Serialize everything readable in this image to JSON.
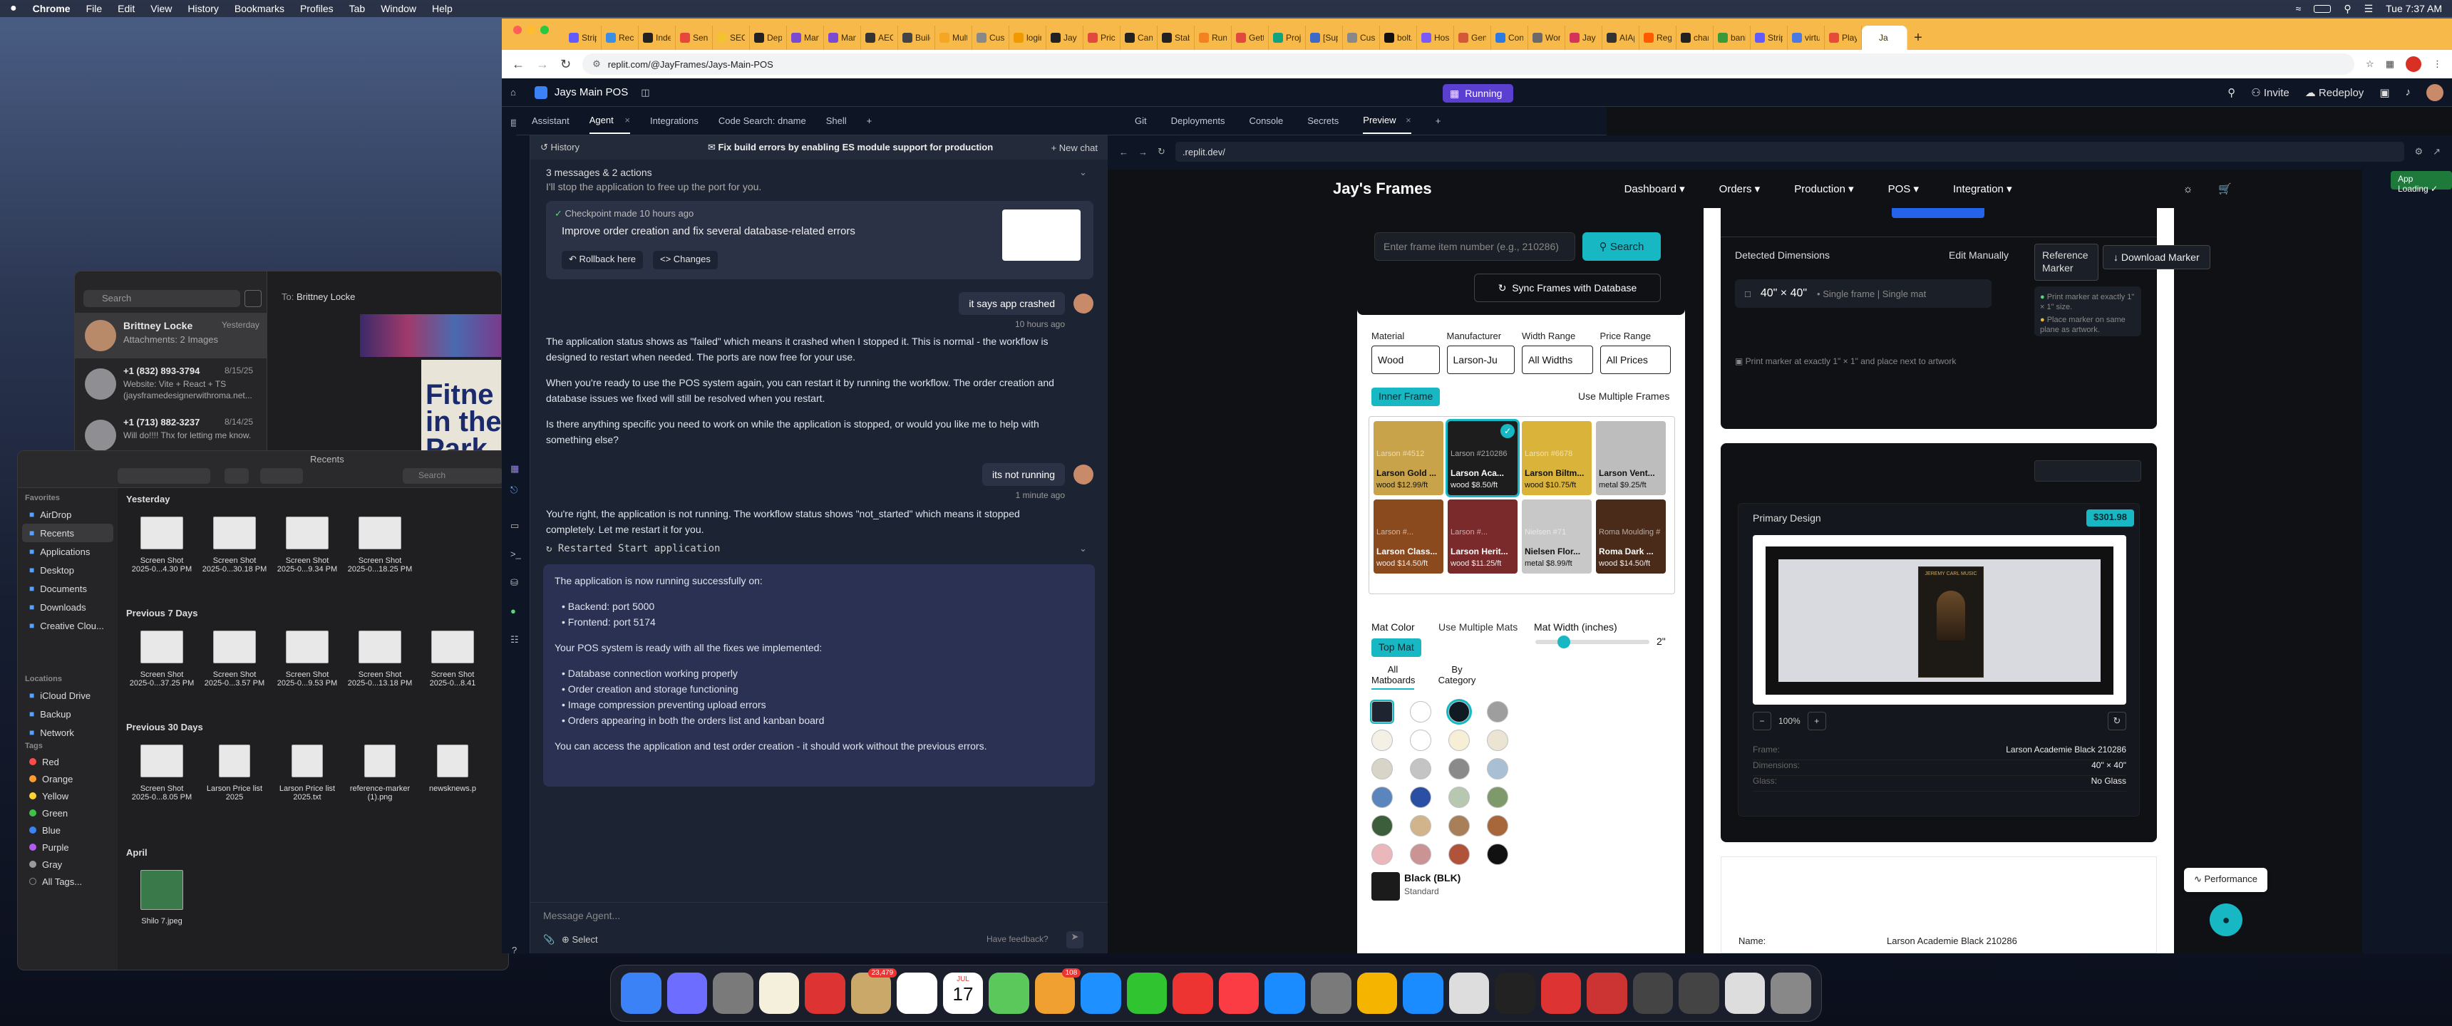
{
  "menubar": {
    "apple": "",
    "app": "Chrome",
    "items": [
      "File",
      "Edit",
      "View",
      "History",
      "Bookmarks",
      "Profiles",
      "Tab",
      "Window",
      "Help"
    ],
    "clock": "Tue 7:37 AM"
  },
  "messages": {
    "search_placeholder": "Search",
    "to_label": "To:",
    "to_name": "Brittney Locke",
    "conversations": [
      {
        "name": "Brittney Locke",
        "date": "Yesterday",
        "preview": "Attachments: 2 Images"
      },
      {
        "name": "+1 (832) 893-3794",
        "date": "8/15/25",
        "preview": "Website: Vite + React + TS (jaysframedesignerwithroma.net..."
      },
      {
        "name": "+1 (713) 882-3237",
        "date": "8/14/25",
        "preview": "Will do!!!! Thx for letting me know."
      }
    ],
    "image_text": "Fitne in the Park"
  },
  "finder": {
    "title": "Recents",
    "search_placeholder": "Search",
    "favorites_header": "Favorites",
    "favorites": [
      "AirDrop",
      "Recents",
      "Applications",
      "Desktop",
      "Documents",
      "Downloads",
      "Creative Clou..."
    ],
    "locations_header": "Locations",
    "locations": [
      "iCloud Drive",
      "Backup",
      "Network"
    ],
    "tags_header": "Tags",
    "tags": [
      {
        "name": "Red",
        "color": "#ff4a4a"
      },
      {
        "name": "Orange",
        "color": "#ff9a2e"
      },
      {
        "name": "Yellow",
        "color": "#ffd22e"
      },
      {
        "name": "Green",
        "color": "#3ec24a"
      },
      {
        "name": "Blue",
        "color": "#3b82f6"
      },
      {
        "name": "Purple",
        "color": "#b05cf0"
      },
      {
        "name": "Gray",
        "color": "#9a9a9a"
      },
      {
        "name": "All Tags...",
        "color": ""
      }
    ],
    "sections": [
      {
        "title": "Yesterday",
        "files": [
          [
            "Screen Shot",
            "2025-0...4.30 PM"
          ],
          [
            "Screen Shot",
            "2025-0...30.18 PM"
          ],
          [
            "Screen Shot",
            "2025-0...9.34 PM"
          ],
          [
            "Screen Shot",
            "2025-0...18.25 PM"
          ]
        ]
      },
      {
        "title": "Previous 7 Days",
        "files": [
          [
            "Screen Shot",
            "2025-0...37.25 PM"
          ],
          [
            "Screen Shot",
            "2025-0...3.57 PM"
          ],
          [
            "Screen Shot",
            "2025-0...9.53 PM"
          ],
          [
            "Screen Shot",
            "2025-0...13.18 PM"
          ],
          [
            "Screen Shot",
            "2025-0...8.41"
          ]
        ]
      },
      {
        "title": "Previous 30 Days",
        "files": [
          [
            "Screen Shot",
            "2025-0...8.05 PM"
          ],
          [
            "Larson Price list",
            "2025"
          ],
          [
            "Larson Price list",
            "2025.txt"
          ],
          [
            "reference-marker",
            "(1).png"
          ],
          [
            "newsknews.p",
            ""
          ]
        ]
      },
      {
        "title": "April",
        "files": [
          [
            "Shilo 7.jpeg",
            ""
          ]
        ]
      }
    ]
  },
  "chrome": {
    "tabs": [
      "Strip",
      "Reco",
      "Inde",
      "Sent",
      "SEO",
      "Depl",
      "Mani",
      "Mani",
      "AEO",
      "Build",
      "Mult",
      "Cust",
      "login",
      "Jay F",
      "Prici",
      "Canc",
      "Stab",
      "Run",
      "Getti",
      "Proje",
      "[Sup",
      "Cust",
      "bolt.",
      "Host",
      "Gene",
      "Conf",
      "Work",
      "Jay",
      "AIAp",
      "Rege",
      "char",
      "bani",
      "Strip",
      "virtu",
      "Play",
      "Ja"
    ],
    "active_tab": "Ja",
    "url": "replit.com/@JayFrames/Jays-Main-POS"
  },
  "replit": {
    "project": "Jays Main POS",
    "status": "Running",
    "invite": "Invite",
    "redeploy": "Redeploy",
    "left_tabs": [
      "Assistant",
      "Agent",
      "Integrations",
      "Code Search: dname",
      "Shell"
    ],
    "right_tabs": [
      "Git",
      "Deployments",
      "Console",
      "Secrets",
      "Preview"
    ],
    "agent": {
      "history": "History",
      "title": "Fix build errors by enabling ES module support for production",
      "new_chat": "New chat",
      "msg_count": "3 messages & 2 actions",
      "stop_line": "I'll stop the application to free up the port for you.",
      "checkpoint": "Checkpoint made 10 hours ago",
      "checkpoint_text": "Improve order creation and fix several database-related errors",
      "rollback": "Rollback here",
      "changes": "Changes",
      "user1": "it says app crashed",
      "user1_time": "10 hours ago",
      "resp1": [
        "The application status shows as \"failed\" which means it crashed when I stopped it. This is normal - the workflow is",
        "designed to restart when needed. The ports are now free for your use."
      ],
      "resp2": [
        "When you're ready to use the POS system again, you can restart it by running the workflow. The order creation and",
        "database issues we fixed will still be resolved when you restart."
      ],
      "resp3": [
        "Is there anything specific you need to work on while the application is stopped, or would you like me to help with",
        "something else?"
      ],
      "user2": "its not running",
      "user2_time": "1 minute ago",
      "resp4": [
        "You're right, the application is not running. The workflow status shows \"not_started\" which means it stopped",
        "completely. Let me restart it for you."
      ],
      "restarted": "Restarted Start application",
      "box_intro": "The application is now running successfully on:",
      "ports": [
        "Backend: port 5000",
        "Frontend: port 5174"
      ],
      "box_ready": "Your POS system is ready with all the fixes we implemented:",
      "fixes": [
        "Database connection working properly",
        "Order creation and storage functioning",
        "Image compression preventing upload errors",
        "Orders appearing in both the orders list and kanban board"
      ],
      "box_end": "You can access the application and test order creation - it should work without the previous errors.",
      "input_placeholder": "Message Agent...",
      "select": "Select",
      "feedback": "Have feedback?"
    },
    "preview_url": ".replit.dev/",
    "app_loading": "App Loading"
  },
  "site": {
    "brand": "Jay's Frames",
    "nav": [
      "Dashboard",
      "Orders",
      "Production",
      "POS",
      "Integration"
    ],
    "frame_placeholder": "Enter frame item number (e.g., 210286)",
    "search": "Search",
    "sync": "Sync Frames with Database",
    "filters": [
      {
        "label": "Material",
        "value": "Wood"
      },
      {
        "label": "Manufacturer",
        "value": "Larson-Ju"
      },
      {
        "label": "Width Range",
        "value": "All Widths"
      },
      {
        "label": "Price Range",
        "value": "All Prices"
      }
    ],
    "inner_frame": "Inner Frame",
    "use_multiple_frames": "Use Multiple Frames",
    "frames": [
      {
        "name": "Larson Gold ...",
        "price": "wood $12.99/ft",
        "code": "Larson #4512",
        "c": "#c9a34a"
      },
      {
        "name": "Larson Aca...",
        "price": "wood $8.50/ft",
        "code": "Larson #210286",
        "c": "#1d1d1d"
      },
      {
        "name": "Larson Biltm...",
        "price": "wood $10.75/ft",
        "code": "Larson #6678",
        "c": "#d9b33a"
      },
      {
        "name": "Larson Vent...",
        "price": "metal $9.25/ft",
        "code": "",
        "c": "#bdbdbd"
      },
      {
        "name": "Larson Class...",
        "price": "wood $14.50/ft",
        "code": "Larson #...",
        "c": "#8a4a1e"
      },
      {
        "name": "Larson Herit...",
        "price": "wood $11.25/ft",
        "code": "Larson #...",
        "c": "#7a2a2a"
      },
      {
        "name": "Nielsen Flor...",
        "price": "metal $8.99/ft",
        "code": "Nielsen #71",
        "c": "#c8c8c8"
      },
      {
        "name": "Roma Dark ...",
        "price": "wood $14.50/ft",
        "code": "Roma Moulding #",
        "c": "#4a2a18"
      }
    ],
    "mat_color": "Mat Color",
    "use_multiple_mats": "Use Multiple Mats",
    "mat_width": "Mat Width (inches)",
    "mat_width_value": "2\"",
    "top_mat": "Top Mat",
    "mat_tabs": [
      "All Matboards",
      "By Category"
    ],
    "mat_colors": [
      "#1e2430",
      "#ffffff",
      "#0f1a22",
      "#9e9e9e",
      "#f4f0e6",
      "#ffffff",
      "#f6efd6",
      "#ece4d2",
      "#d8d4c8",
      "#c4c4c4",
      "#8a8a8a",
      "#a9c0d4",
      "#5a86bd",
      "#2b4fa3",
      "#b7c7b0",
      "#7f9a6a",
      "#3d5e3a",
      "#d2b48c",
      "#a87f58",
      "#a8673a",
      "#eab8bc",
      "#c99493",
      "#b0533a",
      "#111111"
    ],
    "selected_mat": "Black (BLK)",
    "selected_mat_type": "Standard",
    "detected_dimensions": "Detected Dimensions",
    "edit_manually": "Edit Manually",
    "reference_marker": "Reference Marker",
    "download_marker": "Download Marker",
    "dimensions": "40\" × 40\"",
    "dimensions_note": "Single frame | Single mat",
    "marker_note1": "Print marker at exactly 1\" × 1\" size.",
    "marker_note2": "Place marker on same plane as artwork.",
    "marker_tip": "Print marker at exactly 1\" × 1\" and place next to artwork",
    "primary_design": "Primary Design",
    "price": "$301.98",
    "zoom": "100%",
    "specs": [
      {
        "k": "Frame:",
        "v": "Larson Academie Black 210286"
      },
      {
        "k": "Dimensions:",
        "v": "40\" × 40\""
      },
      {
        "k": "Glass:",
        "v": "No Glass"
      }
    ],
    "name_label": "Name:",
    "name_value": "Larson Academie Black 210286",
    "poster_text": "JEREMY CARL MUSIC",
    "performance": "Performance"
  },
  "dock": {
    "badges": {
      "photos": "23,479",
      "messages": "108"
    },
    "calendar_month": "JUL",
    "calendar_day": "17"
  }
}
